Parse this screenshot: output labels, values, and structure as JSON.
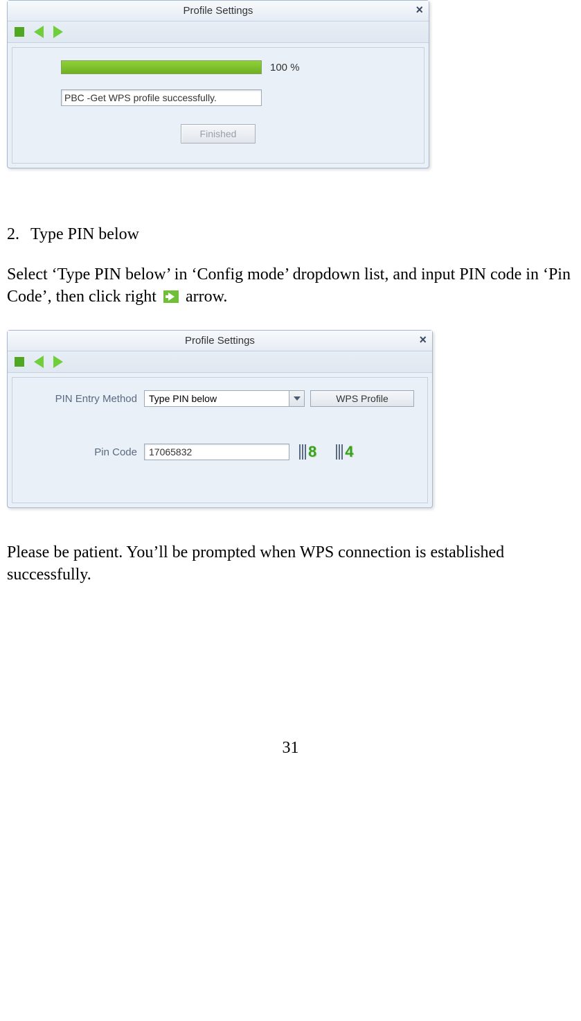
{
  "dialog1": {
    "title": "Profile Settings",
    "progress_pct": "100 %",
    "status_text": "PBC -Get WPS profile successfully.",
    "finished_label": "Finished"
  },
  "section": {
    "number": "2.",
    "heading": "Type PIN below"
  },
  "para1_a": "Select ‘Type PIN below’ in ‘Config mode’ dropdown list, and input PIN code in ‘Pin Code’, then click right",
  "para1_b": "arrow.",
  "dialog2": {
    "title": "Profile Settings",
    "pin_method_label": "PIN Entry Method",
    "pin_method_value": "Type PIN below",
    "wps_profile_label": "WPS Profile",
    "pin_code_label": "Pin Code",
    "pin_code_value": "17065832",
    "digit_8": "8",
    "digit_4": "4"
  },
  "para2": "Please be patient. You’ll be prompted when WPS connection is established successfully.",
  "page_number": "31"
}
